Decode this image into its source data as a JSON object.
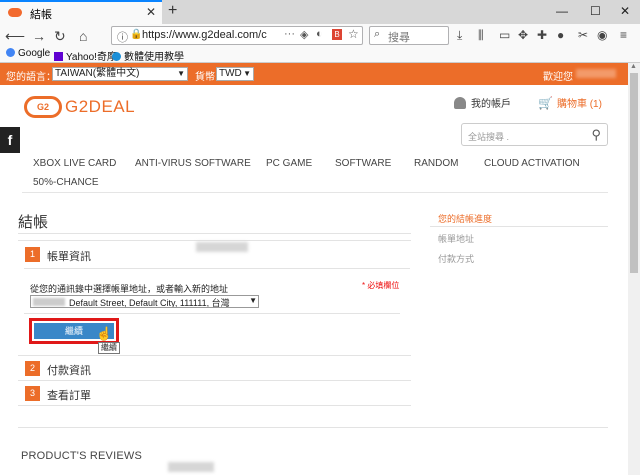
{
  "browser": {
    "tab_title": "結帳",
    "url": "https://www.g2deal.com/c",
    "search_placeholder": "搜尋",
    "bookmarks": [
      "Google",
      "Yahoo!奇摩",
      "數體使用教學"
    ]
  },
  "topbar": {
    "language_label": "您的語言：",
    "language_value": "TAIWAN(繁體中文)",
    "currency_label": "貨幣",
    "currency_value": "TWD",
    "welcome": "歡迎您"
  },
  "header": {
    "logo_text": "G2DEAL",
    "facebook": "f",
    "account_label": "我的帳戶",
    "cart_label": "購物車 (1)",
    "search_placeholder": "全站搜尋 ."
  },
  "nav": [
    "XBOX LIVE CARD",
    "ANTI-VIRUS SOFTWARE",
    "PC GAME",
    "SOFTWARE",
    "RANDOM",
    "CLOUD ACTIVATION",
    "50%-CHANCE"
  ],
  "checkout": {
    "title": "結帳",
    "steps": [
      {
        "num": "1",
        "label": "帳單資訊"
      },
      {
        "num": "2",
        "label": "付款資訊"
      },
      {
        "num": "3",
        "label": "查看訂單"
      }
    ],
    "address_label": "從您的通訊錄中選擇帳單地址，或者輸入新的地址",
    "required_note": "* 必填欄位",
    "address_value": "Default Street, Default City, 111111, 台灣",
    "continue_label": "繼續",
    "tooltip": "繼續"
  },
  "sidebar": {
    "title": "您的結帳進度",
    "items": [
      "帳單地址",
      "付款方式"
    ]
  },
  "reviews_title": "PRODUCT'S REVIEWS",
  "colors": {
    "accent": "#ec6d29",
    "button": "#3a87c8",
    "highlight": "#e01818"
  }
}
